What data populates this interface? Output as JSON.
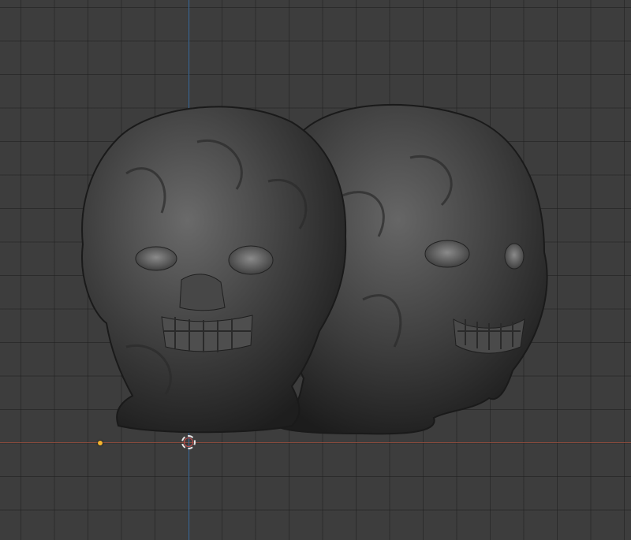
{
  "viewport": {
    "background_color": "#3d3d3d",
    "grid_color": "#2f2f2f",
    "x_axis_color": "#8a4a3c",
    "y_axis_color": "#3f6f9f"
  },
  "scene": {
    "objects": [
      "sculpted-head-front",
      "sculpted-head-side"
    ],
    "origin_marker_color": "#f3b42f",
    "cursor_icon": "3d-cursor-icon"
  }
}
